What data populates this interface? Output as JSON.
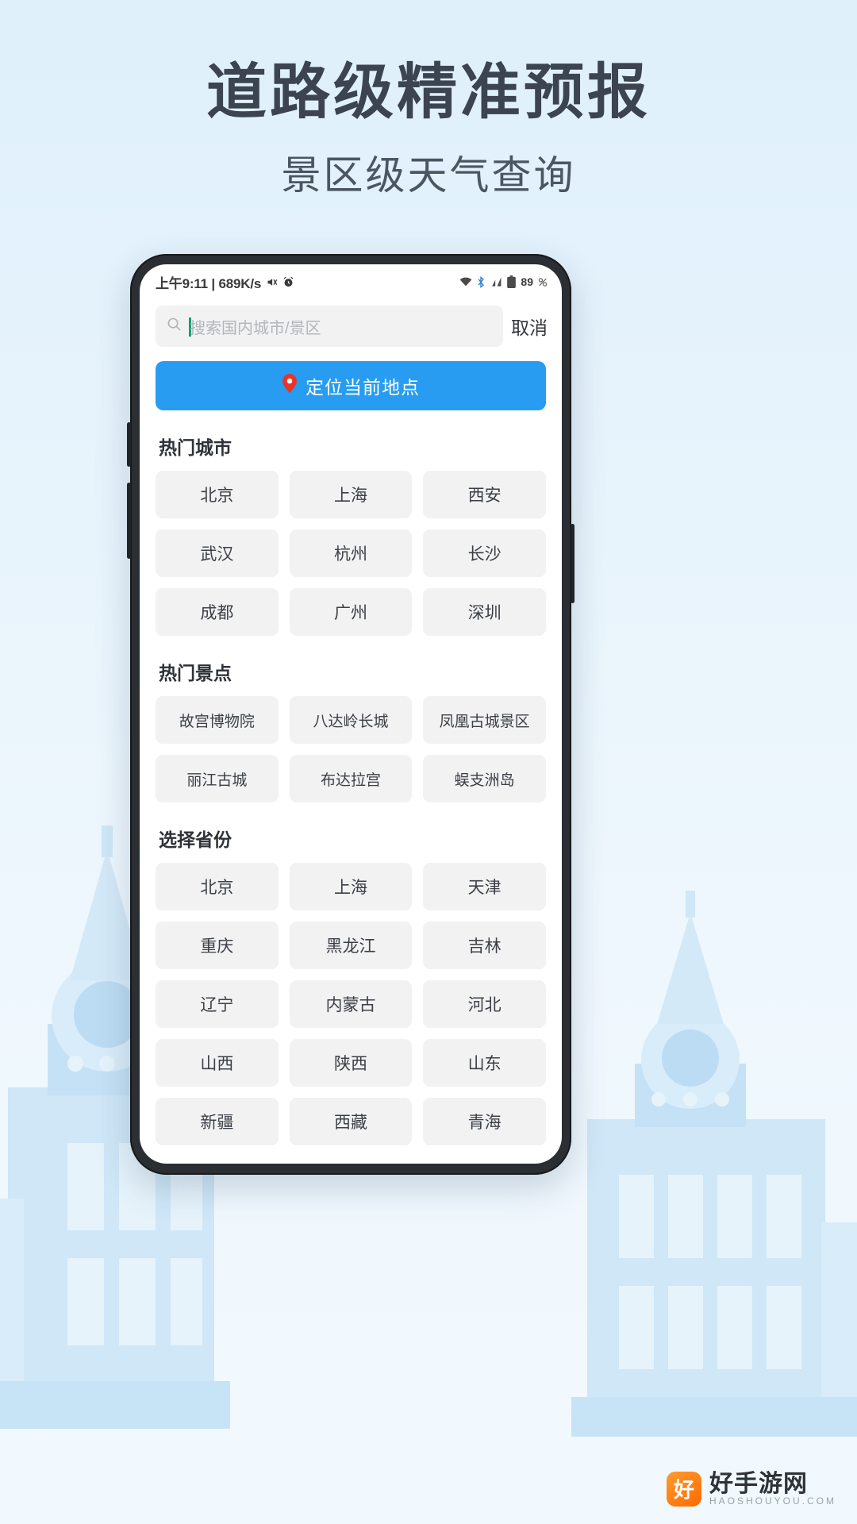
{
  "promo": {
    "headline": "道路级精准预报",
    "subhead": "景区级天气查询"
  },
  "colors": {
    "accent": "#279cf0",
    "chip_bg": "#f2f2f3",
    "pin": "#e8342a",
    "caret": "#0aa06e",
    "page_bg": "#e3f1fb"
  },
  "status_bar": {
    "time": "上午9:11 | 689K/s",
    "mute_icon": "mute-icon",
    "alarm_icon": "alarm-icon",
    "wifi_icon": "wifi-icon",
    "bluetooth_icon": "bluetooth-icon",
    "signal_icon": "signal-icon",
    "battery_icon": "battery-icon",
    "battery_level": "89"
  },
  "search": {
    "placeholder": "搜索国内城市/景区",
    "value": "",
    "icon": "search-icon",
    "cancel_label": "取消"
  },
  "locate": {
    "label": "定位当前地点",
    "icon": "location-pin-icon"
  },
  "sections": [
    {
      "key": "hot_cities",
      "title": "热门城市",
      "items": [
        "北京",
        "上海",
        "西安",
        "武汉",
        "杭州",
        "长沙",
        "成都",
        "广州",
        "深圳"
      ]
    },
    {
      "key": "hot_spots",
      "title": "热门景点",
      "items": [
        "故宫博物院",
        "八达岭长城",
        "凤凰古城景区",
        "丽江古城",
        "布达拉宫",
        "蜈支洲岛"
      ]
    },
    {
      "key": "provinces",
      "title": "选择省份",
      "items": [
        "北京",
        "上海",
        "天津",
        "重庆",
        "黑龙江",
        "吉林",
        "辽宁",
        "内蒙古",
        "河北",
        "山西",
        "陕西",
        "山东",
        "新疆",
        "西藏",
        "青海"
      ]
    }
  ],
  "watermark": {
    "badge": "好",
    "main": "好手游网",
    "sub": "HAOSHOUYOU.COM"
  }
}
